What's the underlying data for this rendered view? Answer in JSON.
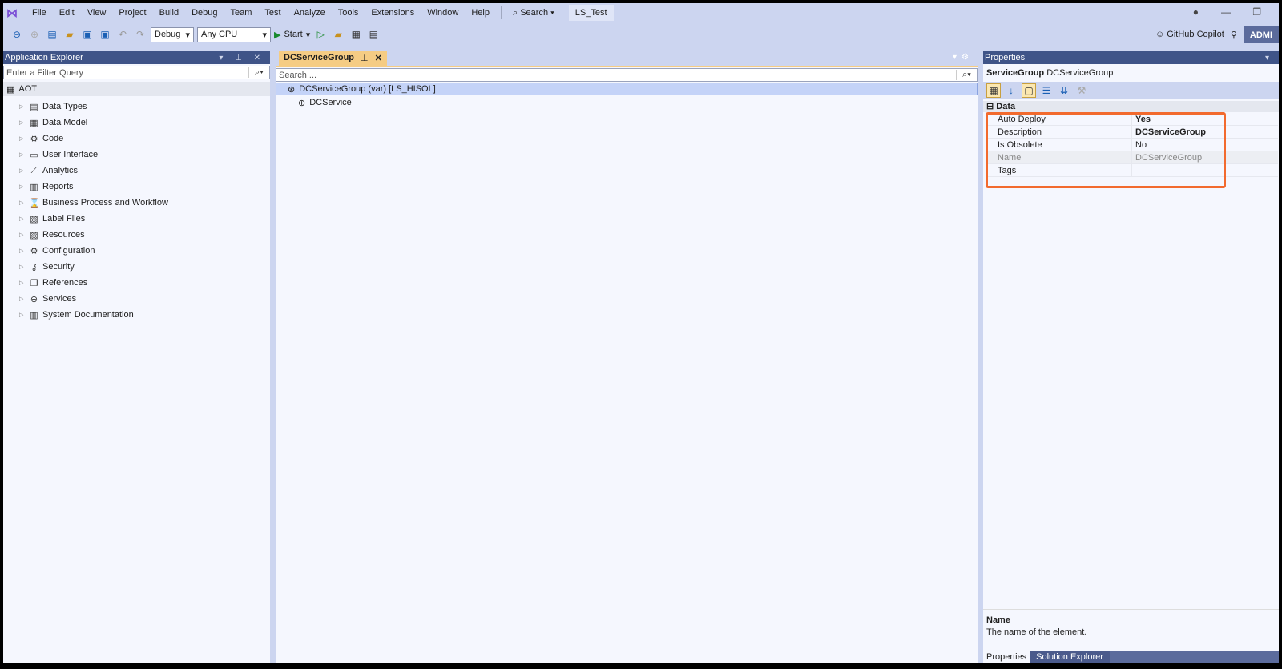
{
  "menu": {
    "items": [
      "File",
      "Edit",
      "View",
      "Project",
      "Build",
      "Debug",
      "Team",
      "Test",
      "Analyze",
      "Tools",
      "Extensions",
      "Window",
      "Help"
    ],
    "search": "Search",
    "solution": "LS_Test"
  },
  "toolbar": {
    "config": "Debug",
    "platform": "Any CPU",
    "start": "Start",
    "copilot": "GitHub Copilot",
    "account": "ADMI"
  },
  "app_explorer": {
    "title": "Application Explorer",
    "filter_placeholder": "Enter a Filter Query",
    "root": "AOT",
    "items": [
      {
        "label": "Data Types",
        "icon": "data-types-icon"
      },
      {
        "label": "Data Model",
        "icon": "table-icon"
      },
      {
        "label": "Code",
        "icon": "code-icon"
      },
      {
        "label": "User Interface",
        "icon": "window-icon"
      },
      {
        "label": "Analytics",
        "icon": "chart-icon"
      },
      {
        "label": "Reports",
        "icon": "report-icon"
      },
      {
        "label": "Business Process and Workflow",
        "icon": "hourglass-icon"
      },
      {
        "label": "Label Files",
        "icon": "label-icon"
      },
      {
        "label": "Resources",
        "icon": "image-icon"
      },
      {
        "label": "Configuration",
        "icon": "gear-icon"
      },
      {
        "label": "Security",
        "icon": "key-icon"
      },
      {
        "label": "References",
        "icon": "reference-icon"
      },
      {
        "label": "Services",
        "icon": "globe-icon"
      },
      {
        "label": "System Documentation",
        "icon": "docs-icon"
      }
    ]
  },
  "editor": {
    "tab": "DCServiceGroup",
    "search_placeholder": "Search ...",
    "root": "DCServiceGroup (var) [LS_HISOL]",
    "child": "DCService"
  },
  "properties": {
    "title": "Properties",
    "object_type": "ServiceGroup",
    "object_name": "DCServiceGroup",
    "category": "Data",
    "rows": [
      {
        "key": "Auto Deploy",
        "value": "Yes",
        "bold": true
      },
      {
        "key": "Description",
        "value": "DCServiceGroup",
        "bold": true
      },
      {
        "key": "Is Obsolete",
        "value": "No"
      },
      {
        "key": "Name",
        "value": "DCServiceGroup",
        "readonly": true
      },
      {
        "key": "Tags",
        "value": ""
      }
    ],
    "desc_title": "Name",
    "desc_text": "The name of the element.",
    "bottom_tabs": [
      "Properties",
      "Solution Explorer"
    ]
  },
  "colors": {
    "highlight": "#f26a2e",
    "panel_header": "#3f5488",
    "active_tab": "#f5cc84"
  }
}
